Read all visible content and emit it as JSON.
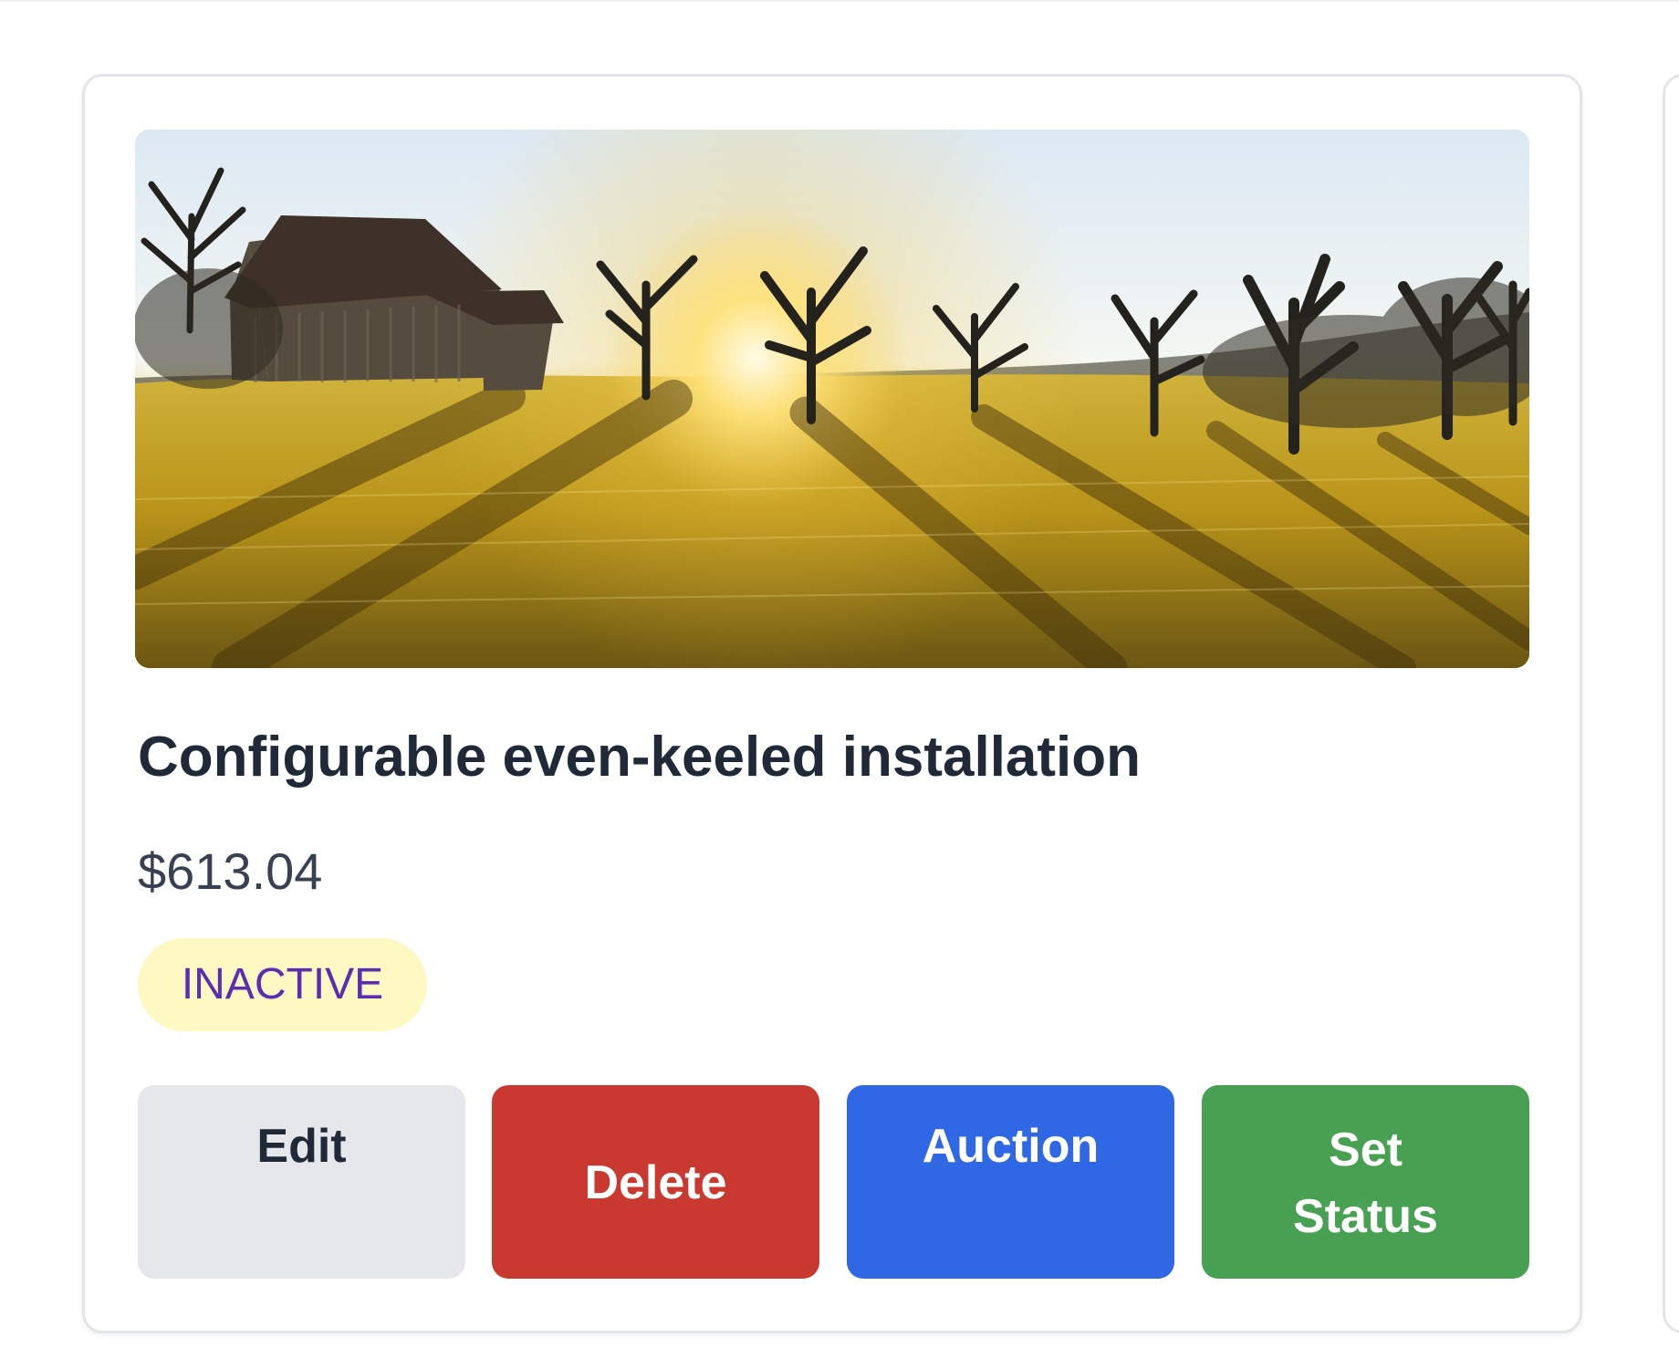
{
  "listing": {
    "title": "Configurable even-keeled installation",
    "price": "$613.04",
    "status": "INACTIVE"
  },
  "actions": {
    "edit_label": "Edit",
    "delete_label": "Delete",
    "auction_label": "Auction",
    "set_status_label_line_1": "Set",
    "set_status_label_line_2": "Status"
  },
  "colors": {
    "card_border": "#e2e5ea",
    "title": "#1f2937",
    "price": "#374151",
    "status_badge_background": "#fef9c3",
    "status_badge_text": "#5b2db0",
    "edit_button": "#e5e7eb",
    "delete_button": "#c93930",
    "auction_button": "#2f67e5",
    "set_status_button": "#48a052"
  }
}
